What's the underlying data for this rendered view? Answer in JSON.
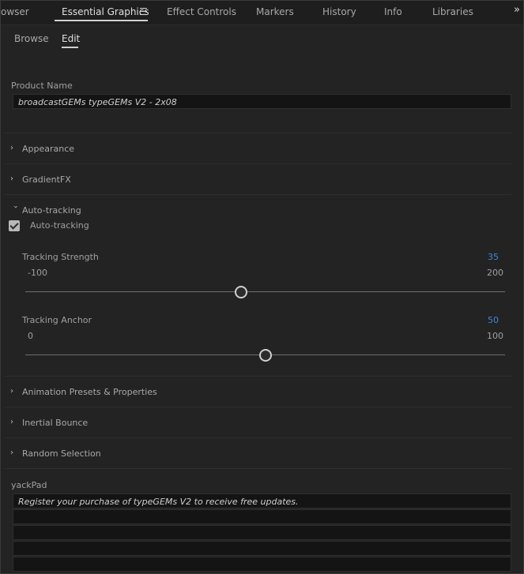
{
  "tabs": [
    {
      "label": "owser"
    },
    {
      "label": "Essential Graphics"
    },
    {
      "label": "Effect Controls"
    },
    {
      "label": "Markers"
    },
    {
      "label": "History"
    },
    {
      "label": "Info"
    },
    {
      "label": "Libraries"
    }
  ],
  "overflow_label": "»",
  "subtabs": [
    {
      "label": "Browse"
    },
    {
      "label": "Edit"
    }
  ],
  "product_name": {
    "label": "Product Name",
    "value": "broadcastGEMs typeGEMs V2 - 2x08"
  },
  "sections": {
    "appearance": "Appearance",
    "gradientfx": "GradientFX",
    "autotracking": "Auto-tracking",
    "animation_presets": "Animation Presets & Properties",
    "inertial_bounce": "Inertial Bounce",
    "random_selection": "Random Selection"
  },
  "autotracking_checkbox": {
    "label": "Auto-tracking",
    "checked": true
  },
  "tracking_strength": {
    "label": "Tracking Strength",
    "value": "35",
    "min": "-100",
    "max": "200",
    "value_num": 35,
    "min_num": -100,
    "max_num": 200
  },
  "tracking_anchor": {
    "label": "Tracking Anchor",
    "value": "50",
    "min": "0",
    "max": "100",
    "value_num": 50,
    "min_num": 0,
    "max_num": 100
  },
  "yackpad": {
    "label": "yackPad",
    "lines": [
      "Register your purchase of typeGEMs V2 to receive free updates.",
      "",
      "",
      "",
      ""
    ]
  },
  "colors": {
    "accent_blue": "#3b88d6",
    "background": "#232323"
  }
}
